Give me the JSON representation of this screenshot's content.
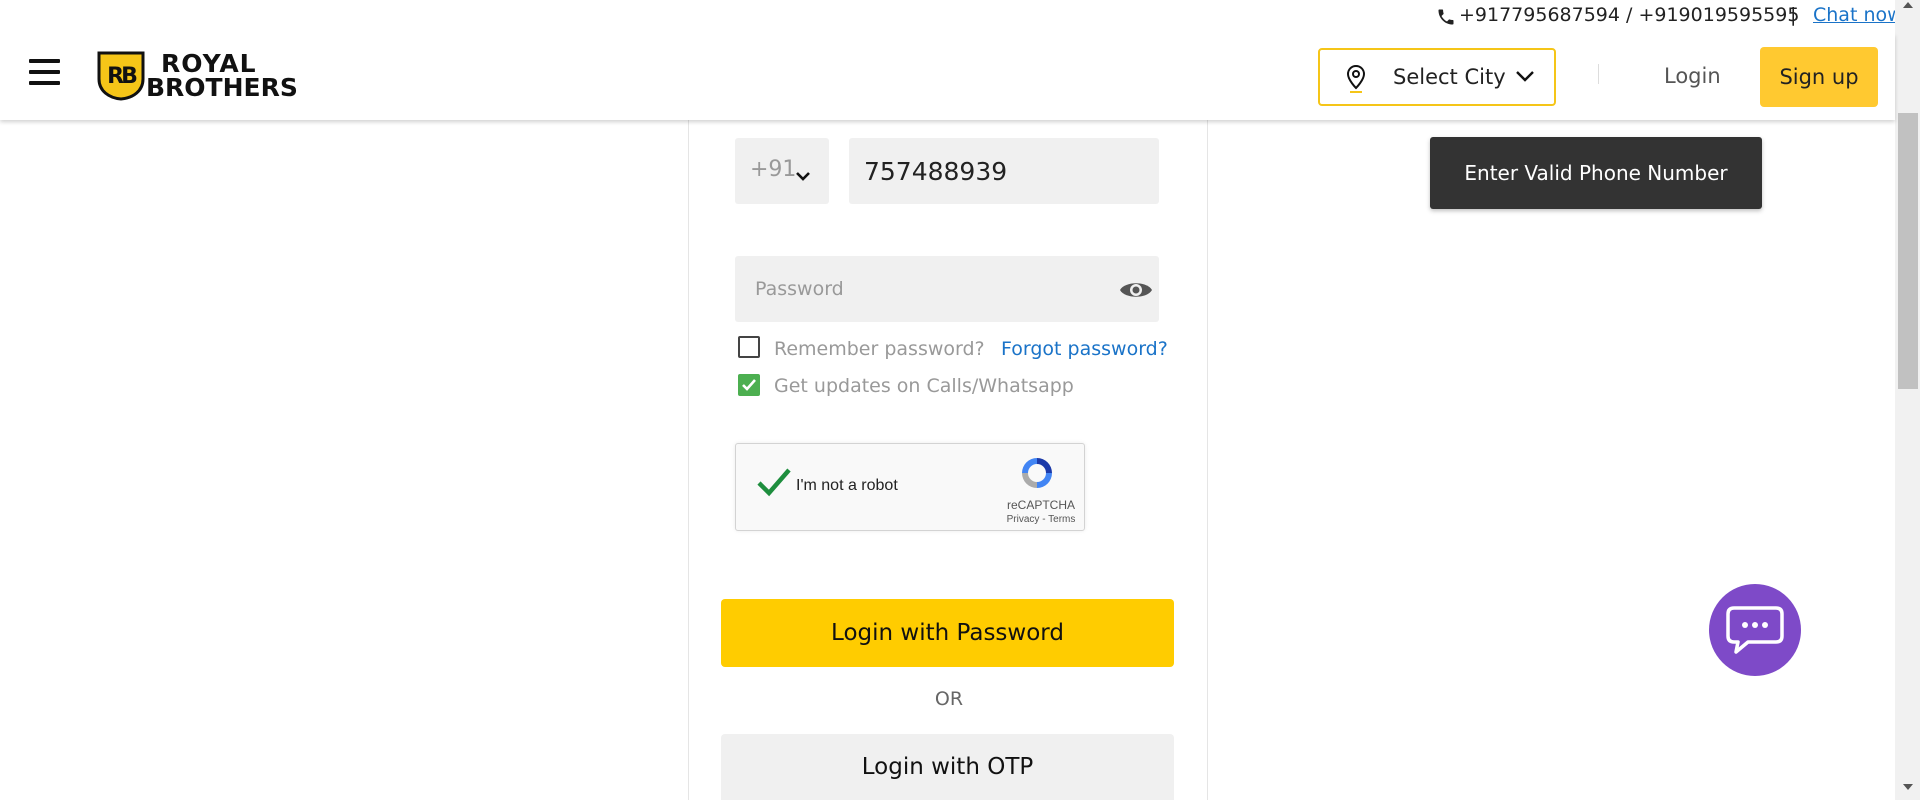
{
  "contact": {
    "phones": "+917795687594 / +919019595595",
    "separator": "|",
    "chat_link": "Chat now"
  },
  "header": {
    "logo_line1": "ROYAL",
    "logo_line2": "BROTHERS",
    "logo_badge": "RB",
    "city_select": "Select City",
    "login": "Login",
    "signup": "Sign up"
  },
  "form": {
    "country_code": "+91",
    "phone_value": "757488939",
    "password_placeholder": "Password",
    "remember_label": "Remember password?",
    "remember_checked": false,
    "forgot_label": "Forgot password?",
    "updates_label": "Get updates on Calls/Whatsapp",
    "updates_checked": true,
    "recaptcha": {
      "label": "I'm not a robot",
      "brand": "reCAPTCHA",
      "links": "Privacy - Terms",
      "verified": true
    },
    "login_password_button": "Login with Password",
    "or_text": "OR",
    "login_otp_button": "Login with OTP"
  },
  "toast": {
    "message": "Enter Valid Phone Number"
  },
  "colors": {
    "brand_yellow": "#ffcc00",
    "signup_yellow": "#ffc930",
    "chat_purple": "#7e4ac8",
    "link_blue": "#1a73c8",
    "check_green": "#4caf50",
    "toast_bg": "#333333"
  },
  "icons": {
    "menu": "hamburger-icon",
    "phone": "phone-icon",
    "city": "location-pin-icon",
    "dropdown": "chevron-down-icon",
    "password_toggle": "eye-icon",
    "chat": "chat-bubble-icon"
  }
}
